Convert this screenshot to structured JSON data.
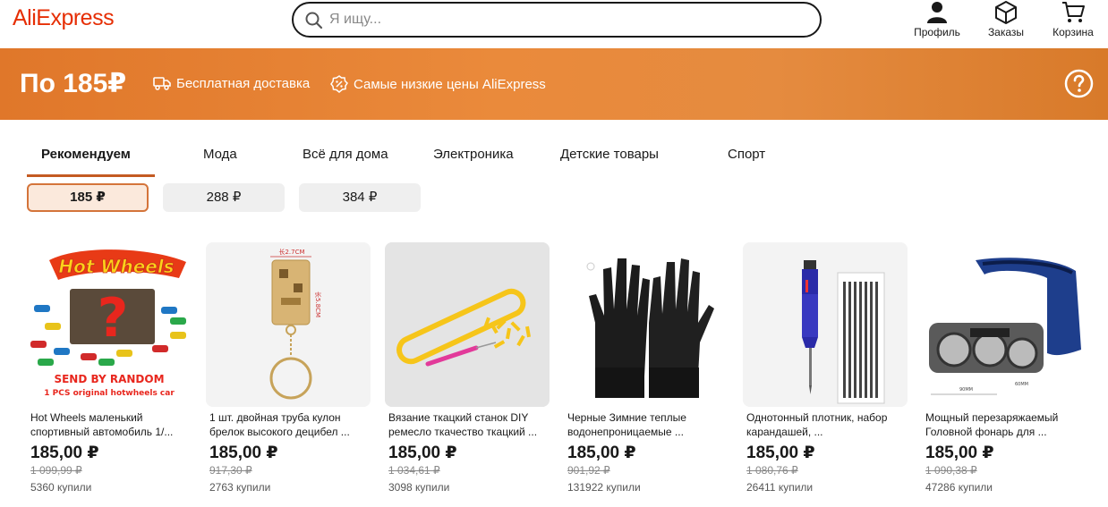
{
  "header": {
    "logo": "AliExpress",
    "search_placeholder": "Я ищу...",
    "profile_label": "Профиль",
    "orders_label": "Заказы",
    "cart_label": "Корзина"
  },
  "banner": {
    "price": "По 185₽",
    "free_delivery": "Бесплатная доставка",
    "lowest_prices": "Самые низкие цены AliExpress",
    "help_icon": "question-circle-icon"
  },
  "tabs": [
    "Рекомендуем",
    "Мода",
    "Всё для дома",
    "Электроника",
    "Детские товары",
    "Спорт"
  ],
  "chips": [
    "185 ₽",
    "288 ₽",
    "384 ₽"
  ],
  "products": [
    {
      "title": "Hot Wheels маленький спортивный автомобиль 1/...",
      "price": "185,00 ₽",
      "old_price": "1 099,99 ₽",
      "sold": "5360 купили",
      "img_text1": "SEND BY RANDOM",
      "img_text2": "1 PCS original hotwheels car"
    },
    {
      "title": "1 шт. двойная труба кулон брелок высокого децибел ...",
      "price": "185,00 ₽",
      "old_price": "917,30 ₽",
      "sold": "2763 купили",
      "dim1": "长2.7CM",
      "dim2": "长5.8CM"
    },
    {
      "title": "Вязание ткацкий станок DIY ремесло ткачество ткацкий ...",
      "price": "185,00 ₽",
      "old_price": "1 034,61 ₽",
      "sold": "3098 купили"
    },
    {
      "title": "Черные Зимние теплые водонепроницаемые ...",
      "price": "185,00 ₽",
      "old_price": "901,92 ₽",
      "sold": "131922 купили"
    },
    {
      "title": "Однотонный плотник, набор карандашей, ...",
      "price": "185,00 ₽",
      "old_price": "1 080,76 ₽",
      "sold": "26411 купили"
    },
    {
      "title": "Мощный перезаряжаемый Головной фонарь для ...",
      "price": "185,00 ₽",
      "old_price": "1 090,38 ₽",
      "sold": "47286 купили",
      "dim1": "90MM",
      "dim2": "60MM"
    }
  ],
  "colors": {
    "brand": "#e62e04",
    "banner": "#e8843a",
    "tab_underline": "#c45a22"
  }
}
